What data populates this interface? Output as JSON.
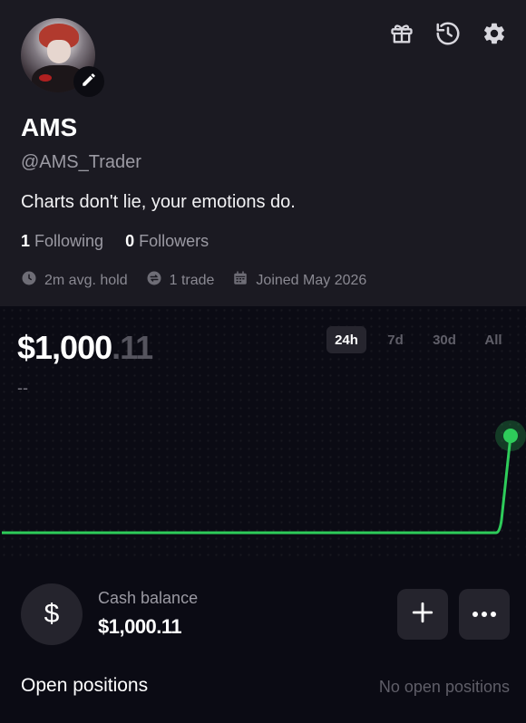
{
  "profile": {
    "name": "AMS",
    "handle": "@AMS_Trader",
    "bio": "Charts don't lie, your emotions do.",
    "following_count": "1",
    "following_label": "Following",
    "followers_count": "0",
    "followers_label": "Followers",
    "meta": {
      "avg_hold": "2m avg. hold",
      "trades": "1 trade",
      "joined": "Joined May 2026"
    }
  },
  "header_icons": [
    "gift-icon",
    "history-icon",
    "settings-icon"
  ],
  "portfolio": {
    "value_main": "$1,000",
    "value_cents": ".11",
    "change": "--",
    "ranges": [
      "24h",
      "7d",
      "30d",
      "All"
    ],
    "active_range": "24h"
  },
  "chart_data": {
    "type": "line",
    "title": "",
    "xlabel": "",
    "ylabel": "",
    "x": [
      0,
      1,
      2,
      3,
      4,
      5,
      6,
      7,
      8,
      9,
      10,
      11,
      12,
      13,
      14,
      15,
      16,
      17,
      18,
      19,
      20,
      21,
      22,
      23,
      24
    ],
    "series": [
      {
        "values": [
          0,
          0,
          0,
          0,
          0,
          0,
          0,
          0,
          0,
          0,
          0,
          0,
          0,
          0,
          0,
          0,
          0,
          0,
          0,
          0,
          0,
          0,
          0,
          0,
          1000.11
        ]
      }
    ],
    "ylim": [
      0,
      1000.11
    ],
    "grid": false,
    "line_color": "#2ecc5a"
  },
  "cash": {
    "label": "Cash balance",
    "amount": "$1,000.11",
    "currency_symbol": "$"
  },
  "positions": {
    "title": "Open positions",
    "empty_text": "No open positions"
  },
  "colors": {
    "background": "#0b0b14",
    "profile_panel": "#1b1a22",
    "accent_green": "#2ecc5a",
    "button_bg": "#25242d"
  }
}
